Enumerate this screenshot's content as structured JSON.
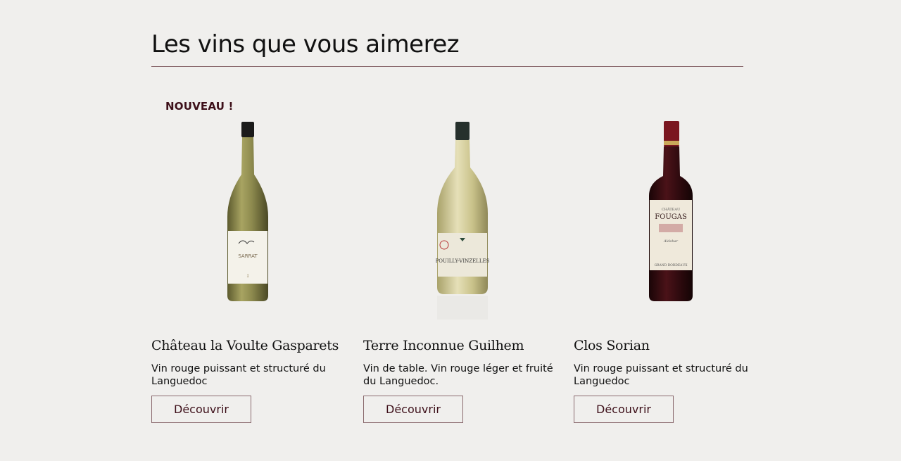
{
  "section": {
    "title": "Les vins que vous aimerez"
  },
  "products": [
    {
      "badge": "NOUVEAU !",
      "name": "Château la Voulte Gasparets",
      "description": "Vin rouge puissant et structuré du Languedoc",
      "button_label": "Découvrir",
      "bottle_color": "#8d8a4e",
      "label_text": "SARRAT"
    },
    {
      "name": "Terre Inconnue Guilhem",
      "description": "Vin de table. Vin rouge léger et fruité du Languedoc.",
      "button_label": "Découvrir",
      "bottle_color": "#c9c28a",
      "label_text": "POUILLY-VINZELLES"
    },
    {
      "name": "Clos Sorian",
      "description": "Vin rouge puissant et structuré du Languedoc",
      "button_label": "Découvrir",
      "bottle_color": "#3a0d12",
      "label_text": "FOUGAS"
    }
  ],
  "colors": {
    "background": "#f0efed",
    "accent": "#3d0f19",
    "divider": "#8a6a6e"
  }
}
